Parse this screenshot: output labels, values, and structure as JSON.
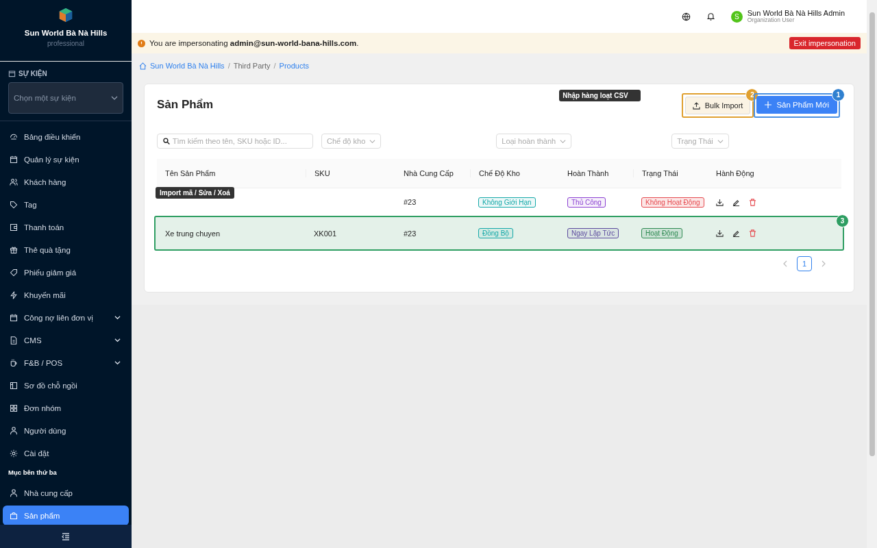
{
  "sidebar": {
    "brand": "Sun World Bà Nà Hills",
    "plan": "professional",
    "event_label": "SỰ KIỆN",
    "event_placeholder": "Chọn một sự kiện",
    "items": [
      {
        "label": "Bảng điều khiển",
        "expandable": false,
        "selected": false
      },
      {
        "label": "Quản lý sự kiện",
        "expandable": false,
        "selected": false
      },
      {
        "label": "Khách hàng",
        "expandable": false,
        "selected": false
      },
      {
        "label": "Tag",
        "expandable": false,
        "selected": false
      },
      {
        "label": "Thanh toán",
        "expandable": false,
        "selected": false
      },
      {
        "label": "Thẻ quà tặng",
        "expandable": false,
        "selected": false
      },
      {
        "label": "Phiếu giảm giá",
        "expandable": false,
        "selected": false
      },
      {
        "label": "Khuyến mãi",
        "expandable": false,
        "selected": false
      },
      {
        "label": "Công nợ liên đơn vị",
        "expandable": true,
        "selected": false
      },
      {
        "label": "CMS",
        "expandable": true,
        "selected": false
      },
      {
        "label": "F&B / POS",
        "expandable": true,
        "selected": false
      },
      {
        "label": "Sơ đồ chỗ ngồi",
        "expandable": false,
        "selected": false
      },
      {
        "label": "Đơn nhóm",
        "expandable": false,
        "selected": false
      },
      {
        "label": "Người dùng",
        "expandable": false,
        "selected": false
      },
      {
        "label": "Cài đặt",
        "expandable": false,
        "selected": false
      }
    ],
    "section_label": "Mục bên thứ ba",
    "section_items": [
      {
        "label": "Nhà cung cấp",
        "selected": false
      },
      {
        "label": "Sản phẩm",
        "selected": true
      }
    ]
  },
  "header": {
    "avatar": "S",
    "user_name": "Sun World Bà Nà Hills Admin",
    "user_role": "Organization User"
  },
  "banner": {
    "text": "You are impersonating **admin@sun-world-bana-hills.com**.",
    "button": "Exit impersonation"
  },
  "breadcrumb": [
    {
      "label": "Sun World Bà Nà Hills",
      "kind": "link"
    },
    {
      "label": "/",
      "kind": "separator"
    },
    {
      "label": "Third Party",
      "kind": "text"
    },
    {
      "label": "/",
      "kind": "separator"
    },
    {
      "label": "Products",
      "kind": "link"
    }
  ],
  "page": {
    "title": "Sản Phẩm",
    "bulk_import": {
      "label": "Bulk Import",
      "step": "2",
      "tooltip": "Nhập hàng loạt CSV"
    },
    "new_product": {
      "label": "Sản Phẩm Mới",
      "step": "1"
    },
    "search_placeholder": "Tìm kiếm theo tên, SKU hoặc ID...",
    "filters": [
      "Chế độ kho",
      "Loại hoàn thành",
      "Trạng Thái"
    ],
    "columns": [
      "Tên Sản Phẩm",
      "SKU",
      "Nhà Cung Cấp",
      "Chế Độ Kho",
      "Hoàn Thành",
      "Trạng Thái",
      "Hành Động"
    ],
    "rows": [
      {
        "supplier": "#23",
        "stock_mode": {
          "label": "Không Giới Hạn",
          "color": "#13a8a8"
        },
        "fulfillment": {
          "label": "Thủ Công",
          "color": "#8a3fd1"
        },
        "status": {
          "label": "Không Hoạt Động",
          "color": "#e5484d"
        },
        "tooltip": "Import mã / Sửa / Xoá"
      },
      {
        "name": "Xe trung chuyen",
        "sku": "XK001",
        "supplier": "#23",
        "stock_mode": {
          "label": "Đồng Bộ",
          "color": "#13a8a8"
        },
        "fulfillment": {
          "label": "Ngay Lập Tức",
          "color": "#5b4a9e"
        },
        "status": {
          "label": "Hoạt Động",
          "color": "#2e8a52"
        },
        "step": "3"
      }
    ],
    "pages": [
      {
        "label": "1",
        "selected": true
      }
    ]
  }
}
